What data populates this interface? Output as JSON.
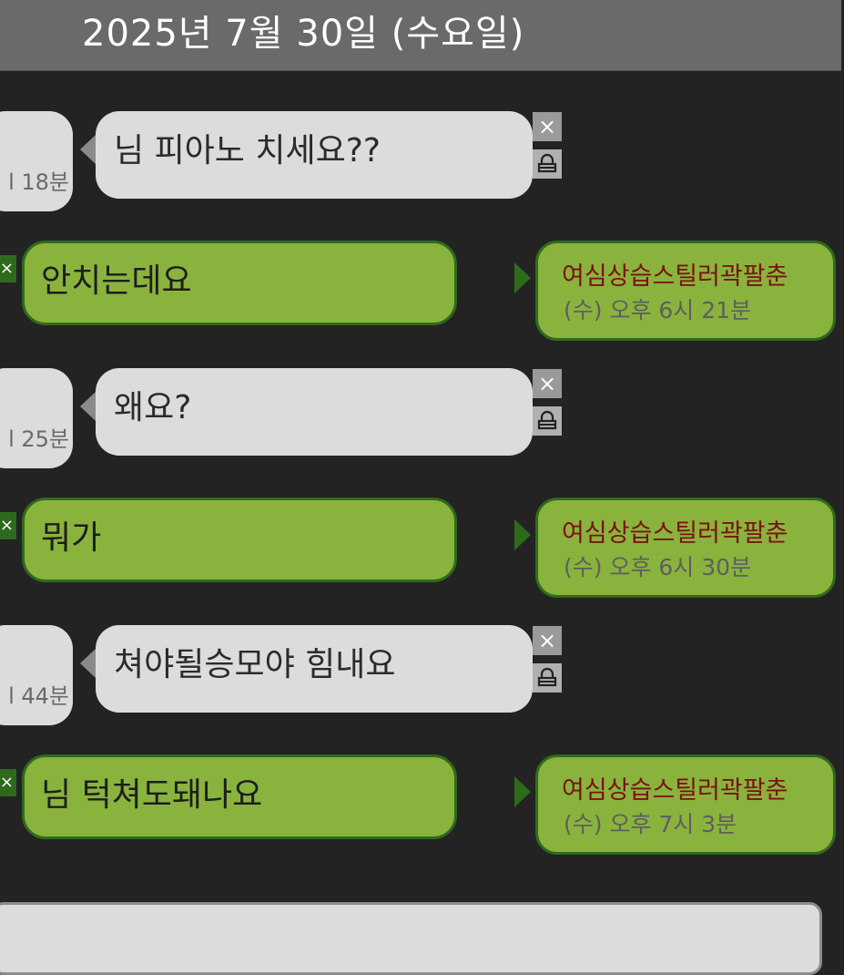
{
  "header": {
    "date": "2025년 7월 30일 (수요일)"
  },
  "messages": [
    {
      "dir": "in",
      "time_stub": "l 18분",
      "text": "님 피아노 치세요??"
    },
    {
      "dir": "out",
      "text": "안치는데요",
      "sender": "여심상습스틸러곽팔춘",
      "time": "(수) 오후 6시 21분"
    },
    {
      "dir": "in",
      "time_stub": "l 25분",
      "text": "왜요?"
    },
    {
      "dir": "out",
      "text": "뭐가",
      "sender": "여심상습스틸러곽팔춘",
      "time": "(수) 오후 6시 30분"
    },
    {
      "dir": "in",
      "time_stub": "l 44분",
      "text": "쳐야될승모야 힘내요"
    },
    {
      "dir": "out",
      "text": "님 턱쳐도돼나요",
      "sender": "여심상습스틸러곽팔춘",
      "time": "(수) 오후 7시 3분"
    }
  ],
  "icons": {
    "delete": "close-icon",
    "lock": "lock-icon"
  },
  "colors": {
    "background": "#232323",
    "header": "#6a6a6a",
    "incoming_bubble": "#dcdcdc",
    "outgoing_bubble": "#89b33d",
    "outgoing_border": "#2f6a1c",
    "sender_name": "#7a1212"
  }
}
